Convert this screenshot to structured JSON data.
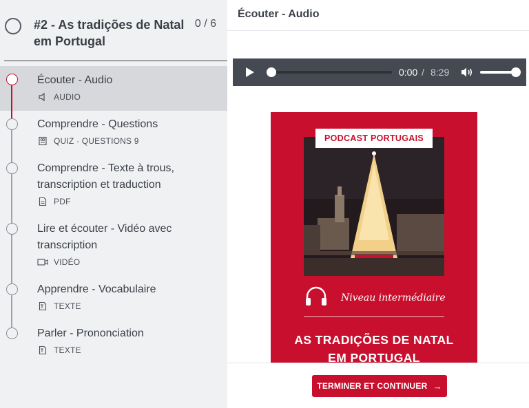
{
  "sidebar": {
    "chapter": {
      "title": "#2 - As tradições de Natal em Portugal",
      "progress": "0 / 6"
    },
    "lessons": [
      {
        "title": "Écouter - Audio",
        "meta": "AUDIO",
        "icon": "speaker-icon",
        "active": true
      },
      {
        "title": "Comprendre - Questions",
        "meta": "QUIZ · QUESTIONS 9",
        "icon": "quiz-icon",
        "active": false
      },
      {
        "title": "Comprendre - Texte à trous, transcription et traduction",
        "meta": "PDF",
        "icon": "pdf-icon",
        "active": false
      },
      {
        "title": "Lire et écouter - Vidéo avec transcription",
        "meta": "VIDÉO",
        "icon": "video-icon",
        "active": false
      },
      {
        "title": "Apprendre - Vocabulaire",
        "meta": "TEXTE",
        "icon": "text-icon",
        "active": false
      },
      {
        "title": "Parler - Prononciation",
        "meta": "TEXTE",
        "icon": "text-icon",
        "active": false
      }
    ]
  },
  "main": {
    "title": "Écouter - Audio",
    "player": {
      "current": "0:00",
      "separator": "/",
      "total": "8:29",
      "progress": 0.0,
      "volume": 1.0
    },
    "poster": {
      "badge": "PODCAST PORTUGAIS",
      "level": "Niveau intermédiaire",
      "headline": "AS TRADIÇÕES DE NATAL EM PORTUGAL",
      "accent": "#c8102e"
    },
    "finish_label": "TERMINER ET CONTINUER",
    "finish_arrow": "→"
  }
}
